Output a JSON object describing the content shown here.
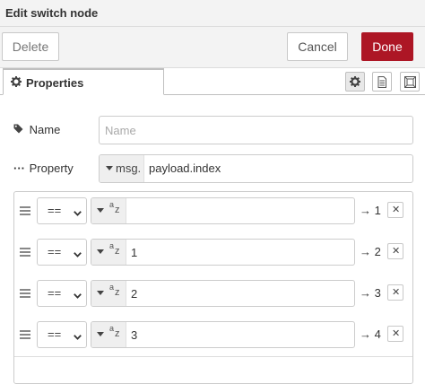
{
  "dialog": {
    "title": "Edit switch node"
  },
  "toolbar": {
    "delete_label": "Delete",
    "cancel_label": "Cancel",
    "done_label": "Done"
  },
  "tabs": {
    "properties_label": "Properties",
    "icons": [
      "gear-icon",
      "document-icon",
      "frame-icon"
    ]
  },
  "form": {
    "name_label": "Name",
    "name_placeholder": "Name",
    "name_value": "",
    "property_label": "Property",
    "property_type": "msg.",
    "property_value": "payload.index"
  },
  "rules": [
    {
      "operator": "==",
      "value_type": "string",
      "value": "",
      "output": "→ 1"
    },
    {
      "operator": "==",
      "value_type": "string",
      "value": "1",
      "output": "→ 2"
    },
    {
      "operator": "==",
      "value_type": "string",
      "value": "2",
      "output": "→ 3"
    },
    {
      "operator": "==",
      "value_type": "string",
      "value": "3",
      "output": "→ 4"
    }
  ],
  "colors": {
    "done_button": "#ad1625",
    "toolbar_bg": "#f3f3f3"
  }
}
